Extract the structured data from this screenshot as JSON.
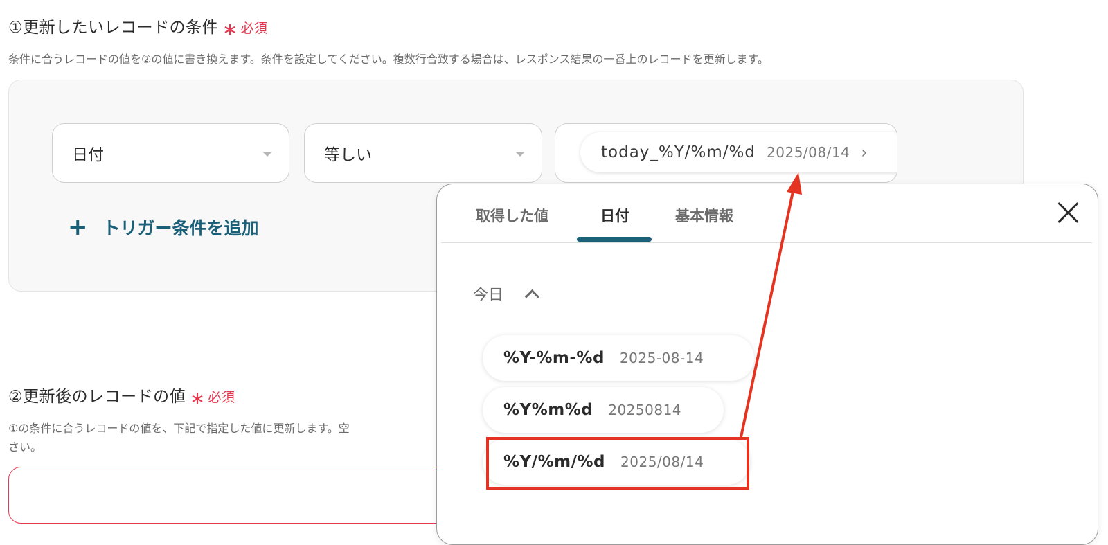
{
  "section1": {
    "title": "①更新したいレコードの条件",
    "required_star": "∗",
    "required_label": "必須",
    "description": "条件に合うレコードの値を②の値に書き換えます。条件を設定してください。複数行合致する場合は、レスポンス結果の一番上のレコードを更新します。",
    "field_select": "日付",
    "operator_select": "等しい",
    "value_token": {
      "key": "today_%Y/%m/%d",
      "example": "2025/08/14",
      "more": "›"
    },
    "add_trigger_plus": "+",
    "add_trigger_label": "トリガー条件を追加"
  },
  "section2": {
    "title": "②更新後のレコードの値",
    "required_star": "∗",
    "required_label": "必須",
    "description_line1": "①の条件に合うレコードの値を、下記で指定した値に更新します。空",
    "description_line2": "さい。"
  },
  "popup": {
    "tabs": [
      {
        "label": "取得した値",
        "active": false
      },
      {
        "label": "日付",
        "active": true
      },
      {
        "label": "基本情報",
        "active": false
      }
    ],
    "group_label": "今日",
    "options": [
      {
        "format": "%Y-%m-%d",
        "example": "2025-08-14"
      },
      {
        "format": "%Y%m%d",
        "example": "20250814"
      },
      {
        "format": "%Y/%m/%d",
        "example": "2025/08/14",
        "highlighted": true
      }
    ]
  },
  "colors": {
    "accent": "#1a6079",
    "required": "#e5384f",
    "annotation": "#e53322"
  }
}
